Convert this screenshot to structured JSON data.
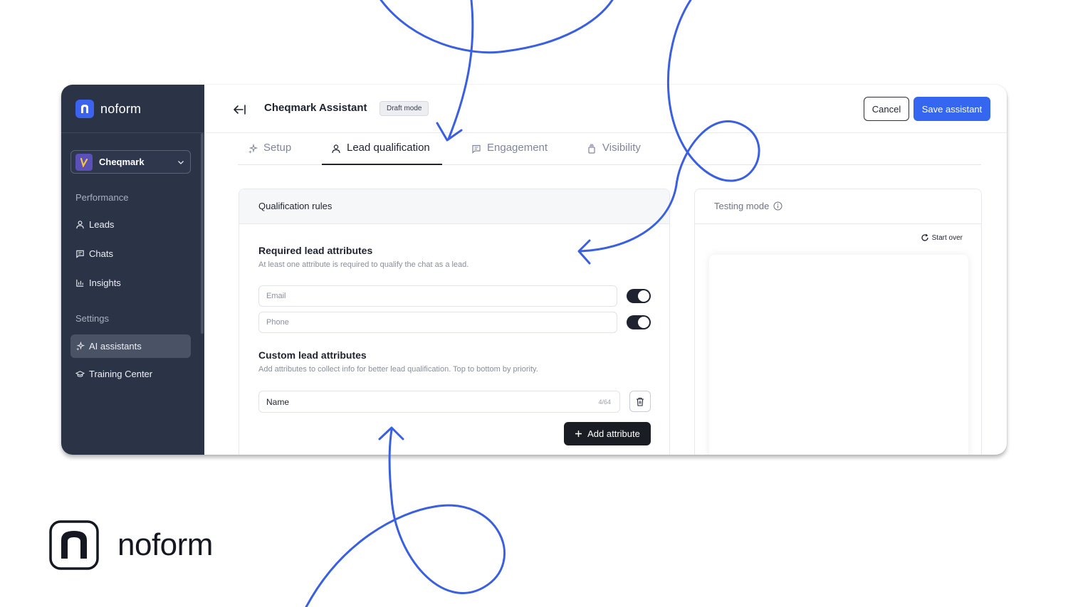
{
  "sidebar": {
    "brand": "noform",
    "workspace": "Cheqmark",
    "sections": {
      "performance": "Performance",
      "settings": "Settings"
    },
    "items": [
      {
        "label": "Leads",
        "icon": "user-icon"
      },
      {
        "label": "Chats",
        "icon": "chat-icon"
      },
      {
        "label": "Insights",
        "icon": "chart-icon"
      },
      {
        "label": "AI assistants",
        "icon": "sparkle-icon",
        "active": true
      },
      {
        "label": "Training Center",
        "icon": "graduation-cap-icon"
      }
    ]
  },
  "header": {
    "title": "Cheqmark Assistant",
    "badge": "Draft mode",
    "cancel": "Cancel",
    "save": "Save assistant"
  },
  "tabs": [
    {
      "label": "Setup",
      "icon": "sparkle-icon"
    },
    {
      "label": "Lead qualification",
      "icon": "user-icon",
      "active": true
    },
    {
      "label": "Engagement",
      "icon": "chat-icon"
    },
    {
      "label": "Visibility",
      "icon": "visibility-icon"
    }
  ],
  "qualification": {
    "title": "Qualification rules",
    "required": {
      "title": "Required lead attributes",
      "subtitle": "At least one attribute is required to qualify the chat as a lead.",
      "fields": [
        {
          "placeholder": "Email",
          "enabled": true
        },
        {
          "placeholder": "Phone",
          "enabled": true
        }
      ]
    },
    "custom": {
      "title": "Custom lead attributes",
      "subtitle": "Add attributes to collect info for better lead qualification. Top to bottom by priority.",
      "attribute_value": "Name",
      "attribute_count": "4/64",
      "add_label": "Add attribute"
    }
  },
  "testing": {
    "title": "Testing mode",
    "start_over": "Start over"
  },
  "footer": {
    "brand": "noform"
  },
  "colors": {
    "accent": "#3566f0",
    "sidebar": "#2b3347",
    "annotation": "#3a5fe0"
  }
}
